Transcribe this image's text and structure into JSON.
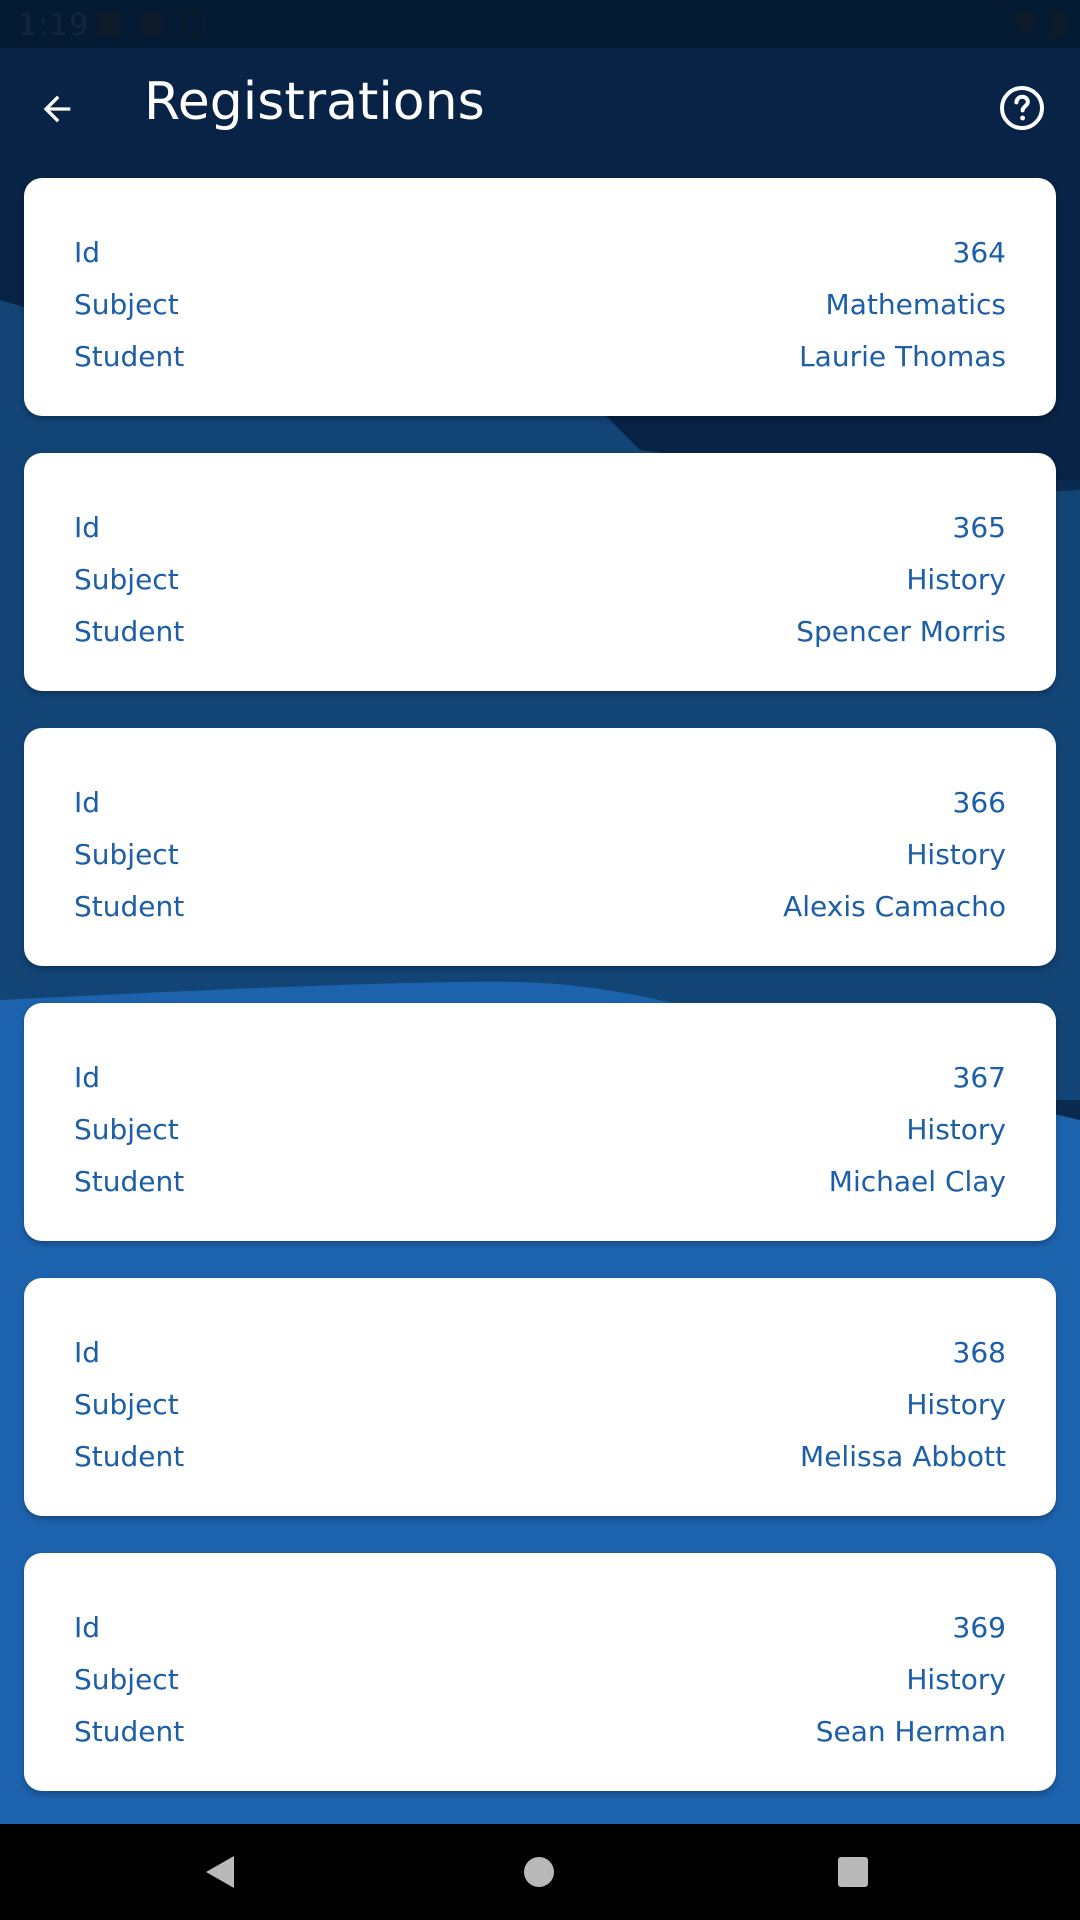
{
  "status_bar": {
    "time": "1:19"
  },
  "app_bar": {
    "title": "Registrations",
    "back_icon": "arrow-left-icon",
    "help_icon": "help-circle-icon"
  },
  "labels": {
    "id": "Id",
    "subject": "Subject",
    "student": "Student"
  },
  "registrations": [
    {
      "id": "364",
      "subject": "Mathematics",
      "student": "Laurie Thomas"
    },
    {
      "id": "365",
      "subject": "History",
      "student": "Spencer Morris"
    },
    {
      "id": "366",
      "subject": "History",
      "student": "Alexis Camacho"
    },
    {
      "id": "367",
      "subject": "History",
      "student": "Michael Clay"
    },
    {
      "id": "368",
      "subject": "History",
      "student": "Melissa Abbott"
    },
    {
      "id": "369",
      "subject": "History",
      "student": "Sean Herman"
    }
  ],
  "colors": {
    "background_dark": "#0b2a4f",
    "background_mid": "#14497f",
    "background_light": "#1c62ad",
    "text_blue": "#1c5ea8",
    "card": "#ffffff"
  }
}
